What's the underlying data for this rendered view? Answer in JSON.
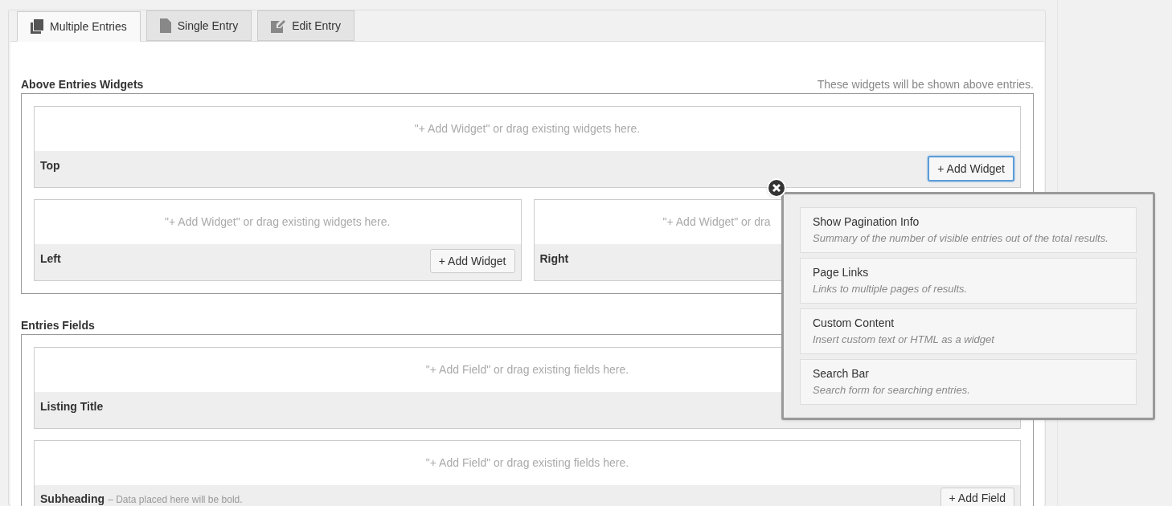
{
  "tabs": [
    {
      "label": "Multiple Entries",
      "selected": true
    },
    {
      "label": "Single Entry",
      "selected": false
    },
    {
      "label": "Edit Entry",
      "selected": false
    }
  ],
  "widgets_section": {
    "title": "Above Entries Widgets",
    "hint": "These widgets will be shown above entries.",
    "top": {
      "placeholder": "\"+ Add Widget\" or drag existing widgets here.",
      "label": "Top",
      "button": "+ Add Widget",
      "focused": true
    },
    "left": {
      "placeholder": "\"+ Add Widget\" or drag existing widgets here.",
      "label": "Left",
      "button": "+ Add Widget",
      "focused": false
    },
    "right": {
      "placeholder": "\"+ Add Widget\" or dra",
      "label": "Right"
    }
  },
  "fields_section": {
    "title": "Entries Fields",
    "listing_title": {
      "placeholder": "\"+ Add Field\" or drag existing fields here.",
      "label": "Listing Title"
    },
    "subheading": {
      "placeholder": "\"+ Add Field\" or drag existing fields here.",
      "label": "Subheading",
      "note": "– Data placed here will be bold.",
      "button": "+ Add Field"
    }
  },
  "popover": {
    "items": [
      {
        "title": "Show Pagination Info",
        "description": "Summary of the number of visible entries out of the total results."
      },
      {
        "title": "Page Links",
        "description": "Links to multiple pages of results."
      },
      {
        "title": "Custom Content",
        "description": "Insert custom text or HTML as a widget"
      },
      {
        "title": "Search Bar",
        "description": "Search form for searching entries."
      }
    ]
  }
}
